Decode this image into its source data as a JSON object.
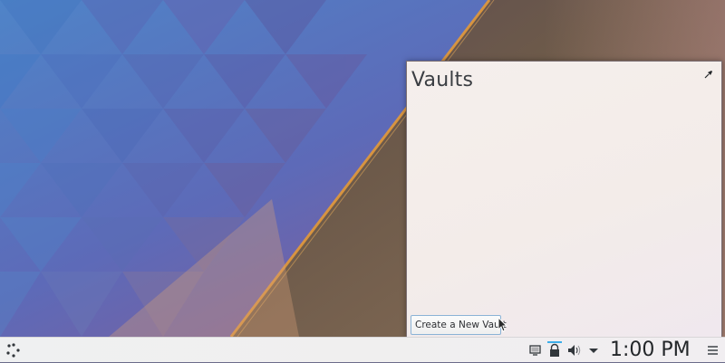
{
  "popup": {
    "title": "Vaults",
    "create_button_label": "Create a New Vault",
    "pin_icon": "pin-icon"
  },
  "panel": {
    "launcher_icon": "application-launcher-icon",
    "tray_icons": [
      "network-icon",
      "vaults-lock-icon",
      "volume-icon",
      "expand-arrow-icon"
    ],
    "clock": "1:00 PM",
    "menu_icon": "panel-menu-icon"
  },
  "colors": {
    "accent": "#3daee9",
    "popup_bg": "#f4eeeb",
    "text": "#3b3e43"
  }
}
